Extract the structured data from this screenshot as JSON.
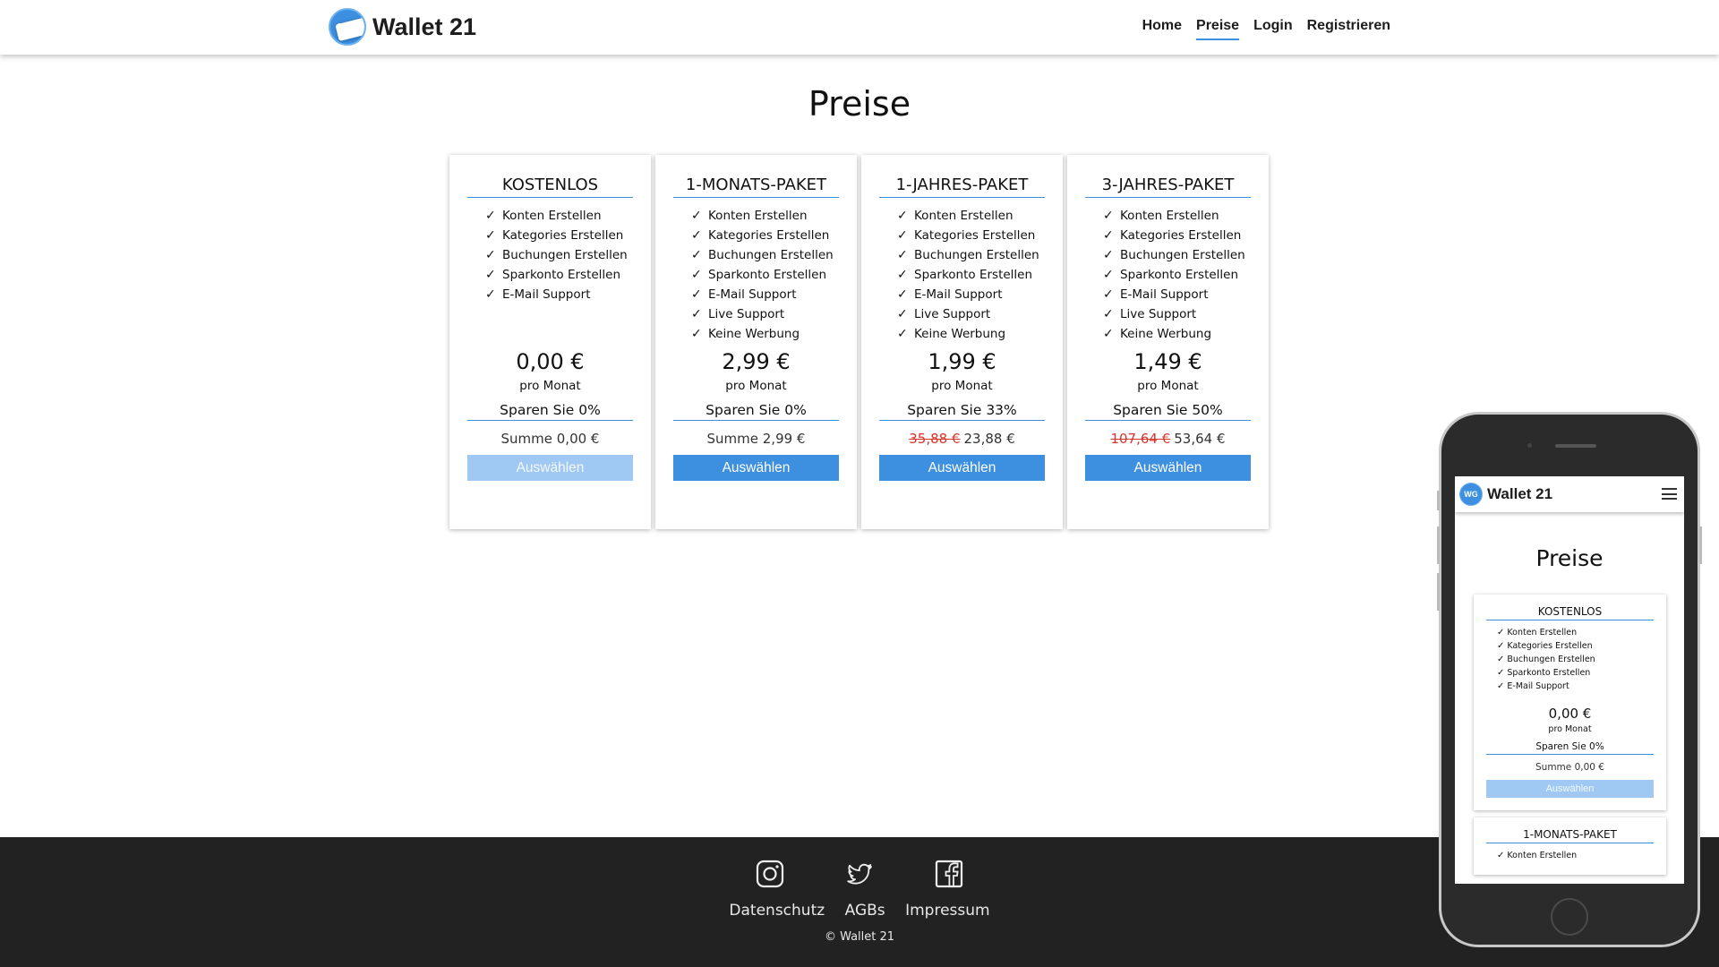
{
  "nav": {
    "brand": "Wallet 21",
    "logo_text": "WG",
    "links": [
      "Home",
      "Preise",
      "Login",
      "Registrieren"
    ],
    "active": "Preise"
  },
  "page": {
    "title": "Preise"
  },
  "plans": [
    {
      "title": "KOSTENLOS",
      "features": [
        "Konten Erstellen",
        "Kategories Erstellen",
        "Buchungen Erstellen",
        "Sparkonto Erstellen",
        "E-Mail Support"
      ],
      "price": "0,00 €",
      "per": "pro Monat",
      "save": "Sparen Sie 0%",
      "sum_old": "",
      "sum": "Summe 0,00 €",
      "button": "Auswählen",
      "button_enabled": false
    },
    {
      "title": "1-MONATS-PAKET",
      "features": [
        "Konten Erstellen",
        "Kategories Erstellen",
        "Buchungen Erstellen",
        "Sparkonto Erstellen",
        "E-Mail Support",
        "Live Support",
        "Keine Werbung"
      ],
      "price": "2,99 €",
      "per": "pro Monat",
      "save": "Sparen Sie 0%",
      "sum_old": "",
      "sum": "Summe 2,99 €",
      "button": "Auswählen",
      "button_enabled": true
    },
    {
      "title": "1-JAHRES-PAKET",
      "features": [
        "Konten Erstellen",
        "Kategories Erstellen",
        "Buchungen Erstellen",
        "Sparkonto Erstellen",
        "E-Mail Support",
        "Live Support",
        "Keine Werbung"
      ],
      "price": "1,99 €",
      "per": "pro Monat",
      "save": "Sparen Sie 33%",
      "sum_old": "35,88 €",
      "sum": "23,88 €",
      "button": "Auswählen",
      "button_enabled": true
    },
    {
      "title": "3-JAHRES-PAKET",
      "features": [
        "Konten Erstellen",
        "Kategories Erstellen",
        "Buchungen Erstellen",
        "Sparkonto Erstellen",
        "E-Mail Support",
        "Live Support",
        "Keine Werbung"
      ],
      "price": "1,49 €",
      "per": "pro Monat",
      "save": "Sparen Sie 50%",
      "sum_old": "107,64 €",
      "sum": "53,64 €",
      "button": "Auswählen",
      "button_enabled": true
    }
  ],
  "footer": {
    "icons": [
      "instagram-icon",
      "twitter-icon",
      "facebook-icon"
    ],
    "links": [
      "Datenschutz",
      "AGBs",
      "Impressum"
    ],
    "copyright": "© Wallet 21"
  },
  "phone": {
    "brand": "Wallet 21",
    "logo_text": "WG",
    "title": "Preise",
    "card": {
      "title": "KOSTENLOS",
      "features": [
        "Konten Erstellen",
        "Kategories Erstellen",
        "Buchungen Erstellen",
        "Sparkonto Erstellen",
        "E-Mail Support"
      ],
      "price": "0,00 €",
      "per": "pro Monat",
      "save": "Sparen Sie 0%",
      "sum": "Summe 0,00 €",
      "button": "Auswählen"
    },
    "next_card": {
      "title": "1-MONATS-PAKET",
      "first_feature": "Konten Erstellen"
    }
  },
  "colors": {
    "accent": "#3d8fe0",
    "button_disabled": "#9fc9f2",
    "footer_bg": "#222222",
    "old_price": "#d9342b"
  }
}
